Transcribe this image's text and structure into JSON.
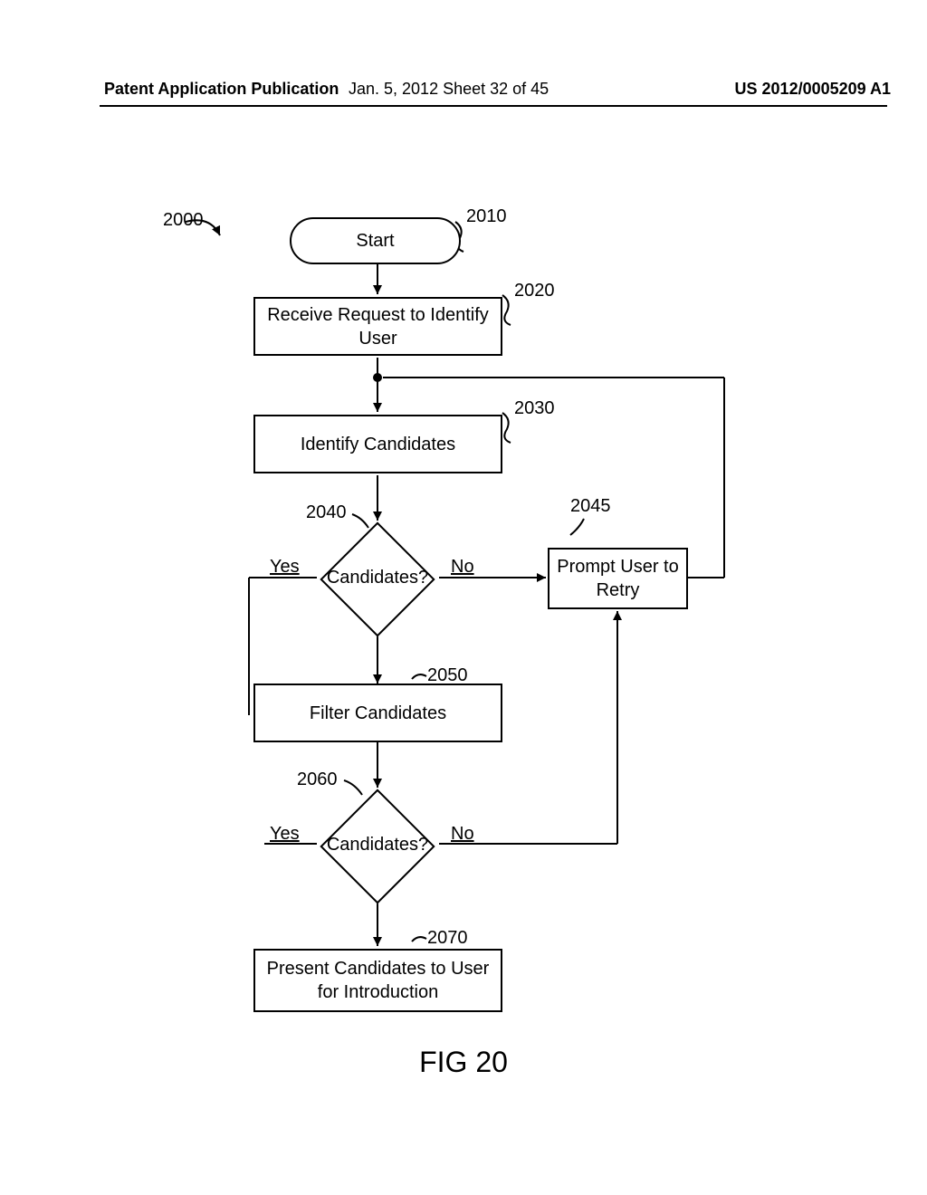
{
  "header": {
    "left": "Patent Application Publication",
    "mid": "Jan. 5, 2012   Sheet 32 of 45",
    "right": "US 2012/0005209 A1"
  },
  "refs": {
    "r2000": "2000",
    "r2010": "2010",
    "r2020": "2020",
    "r2030": "2030",
    "r2040": "2040",
    "r2045": "2045",
    "r2050": "2050",
    "r2060": "2060",
    "r2070": "2070"
  },
  "nodes": {
    "start": "Start",
    "receive": "Receive Request to Identify User",
    "identify": "Identify Candidates",
    "candidates1": "Candidates?",
    "candidates2": "Candidates?",
    "filter": "Filter Candidates",
    "retry": "Prompt User to Retry",
    "present": "Present Candidates to User for Introduction"
  },
  "edges": {
    "yes": "Yes",
    "no": "No"
  },
  "figure": "FIG 20"
}
